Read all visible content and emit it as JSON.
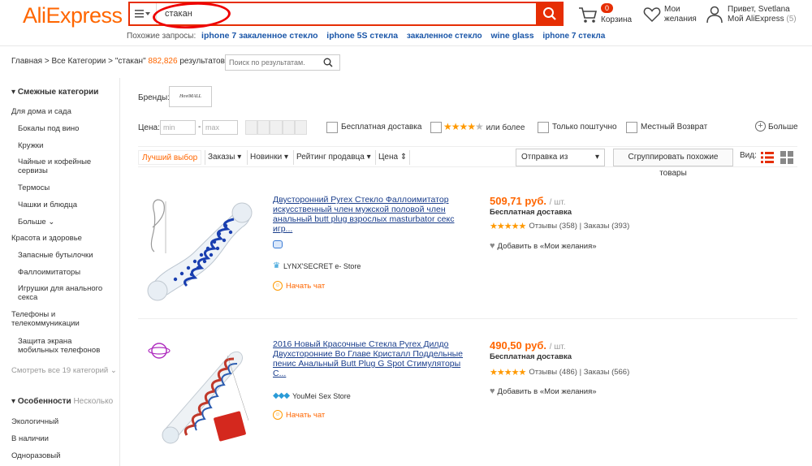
{
  "header": {
    "logo": "AliExpress",
    "search_value": "стакан",
    "cart_count": "0",
    "cart_label": "Корзина",
    "wish_line1": "Мои",
    "wish_line2": "желания",
    "account_greeting": "Привет, Svetlana",
    "account_link": "Мой AliExpress",
    "account_count": "(5)",
    "related_label": "Похожие запросы:",
    "related_queries": [
      "iphone 7 закаленное стекло",
      "iphone 5S стекла",
      "закаленное стекло",
      "wine glass",
      "iphone 7 стекла"
    ]
  },
  "breadcrumb": {
    "home": "Главная",
    "all": "Все Категории",
    "query": "\"стакан\"",
    "count": "882,826",
    "results": "результатов",
    "search_placeholder": "Поиск по результатам."
  },
  "sidebar": {
    "related_head": "Смежные категории",
    "items": [
      {
        "label": "Для дома и сада",
        "level": 0
      },
      {
        "label": "Бокалы под вино",
        "level": 1
      },
      {
        "label": "Кружки",
        "level": 1
      },
      {
        "label": "Чайные и кофейные сервизы",
        "level": 1
      },
      {
        "label": "Термосы",
        "level": 1
      },
      {
        "label": "Чашки и блюдца",
        "level": 1
      },
      {
        "label": "Больше",
        "level": 1
      },
      {
        "label": "Красота и здоровье",
        "level": 0
      },
      {
        "label": "Запасные бутылочки",
        "level": 1
      },
      {
        "label": "Фаллоимитаторы",
        "level": 1
      },
      {
        "label": "Игрушки для анального секса",
        "level": 1
      },
      {
        "label": "Телефоны и телекоммуникации",
        "level": 0
      },
      {
        "label": "Защита экрана мобильных телефонов",
        "level": 1
      }
    ],
    "see_all": "Смотреть все 19 категорий",
    "features_head": "Особенности",
    "features_note": "Несколько",
    "features": [
      "Экологичный",
      "В наличии",
      "Одноразовый"
    ]
  },
  "filters": {
    "brands_label": "Бренды:",
    "brand_name": "HoviMALL",
    "price_label": "Цена:",
    "min_placeholder": "min",
    "max_placeholder": "max",
    "free_shipping": "Бесплатная доставка",
    "rating_more": "или более",
    "single_piece": "Только поштучно",
    "local_return": "Местный Возврат",
    "more": "Больше"
  },
  "sort": {
    "best": "Лучший выбор",
    "orders": "Заказы",
    "new": "Новинки",
    "seller_rating": "Рейтинг продавца",
    "price": "Цена",
    "ship_from": "Отправка из",
    "group_similar": "Сгруппировать похожие товары",
    "view_label": "Вид:"
  },
  "products": [
    {
      "title": "Двусторонний Pyrex Стекло Фаллоимитатор искусственный член мужской половой член анальный butt plug взрослых masturbator секс игр...",
      "store": "LYNX'SECRET e- Store",
      "chat": "Начать чат",
      "price": "509,71 руб.",
      "unit": "/ шт.",
      "shipping": "Бесплатная доставка",
      "reviews": "Отзывы (358)",
      "orders": "Заказы (393)",
      "wish": "Добавить в «Мои желания»"
    },
    {
      "title": "2016 Новый Красочные Стекла Pyrex Дилдо Двухсторонние Во Главе Кристалл Поддельные пенис Анальный Butt Plug G Spot Стимуляторы С...",
      "store": "YouMei Sex Store",
      "chat": "Начать чат",
      "price": "490,50 руб.",
      "unit": "/ шт.",
      "shipping": "Бесплатная доставка",
      "reviews": "Отзывы (486)",
      "orders": "Заказы (566)",
      "wish": "Добавить в «Мои желания»"
    }
  ],
  "colors": {
    "brand": "#ff6600",
    "accent_red": "#e62e04",
    "link": "#1a56a8",
    "star": "#ff9900"
  }
}
